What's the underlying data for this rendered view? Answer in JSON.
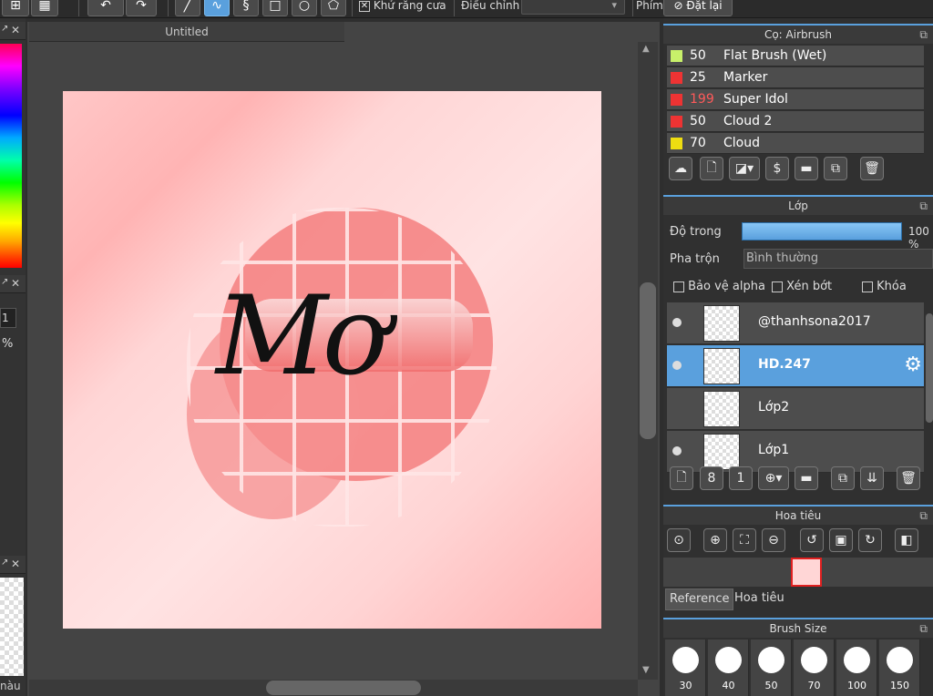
{
  "toolbar": {
    "antialias_label": "Khử răng cưa",
    "adjust_label": "Điều chỉnh",
    "shortcut_label": "Phím",
    "reset_label": "Đặt lại"
  },
  "left_strip": {
    "field_value": "1",
    "percent": "%",
    "bottom_label": "nàu"
  },
  "document": {
    "tab_title": "Untitled"
  },
  "brush_panel": {
    "title": "Cọ: Airbrush",
    "brushes": [
      {
        "size": "50",
        "name": "Flat Brush (Wet)",
        "color": "#c8f06a"
      },
      {
        "size": "25",
        "name": "Marker",
        "color": "#ee3333"
      },
      {
        "size": "199",
        "name": "Super Idol",
        "color": "#ee3333"
      },
      {
        "size": "50",
        "name": "Cloud 2",
        "color": "#ee3333"
      },
      {
        "size": "70",
        "name": "Cloud",
        "color": "#eedd11"
      }
    ]
  },
  "layer_panel": {
    "title": "Lớp",
    "opacity_label": "Độ trong",
    "opacity_value": "100 %",
    "opacity": 100,
    "blend_label": "Pha trộn",
    "blend_value": "Bình thường",
    "protect_alpha": "Bảo vệ alpha",
    "clipping": "Xén bớt",
    "lock": "Khóa",
    "layers": [
      {
        "name": "@thanhsona2017",
        "visible": true,
        "selected": false
      },
      {
        "name": "HD.247",
        "visible": true,
        "selected": true
      },
      {
        "name": "Lớp2",
        "visible": false,
        "selected": false
      },
      {
        "name": "Lớp1",
        "visible": true,
        "selected": false
      }
    ]
  },
  "navigator_panel": {
    "title": "Hoa tiêu",
    "tabs": [
      "Reference",
      "Hoa tiêu"
    ]
  },
  "brush_size_panel": {
    "title": "Brush Size",
    "sizes": [
      "30",
      "40",
      "50",
      "70",
      "100",
      "150"
    ]
  },
  "artwork": {
    "text": "Mơ"
  },
  "colors": {
    "accent": "#5aa0dd",
    "panel": "#4d4d4d"
  }
}
